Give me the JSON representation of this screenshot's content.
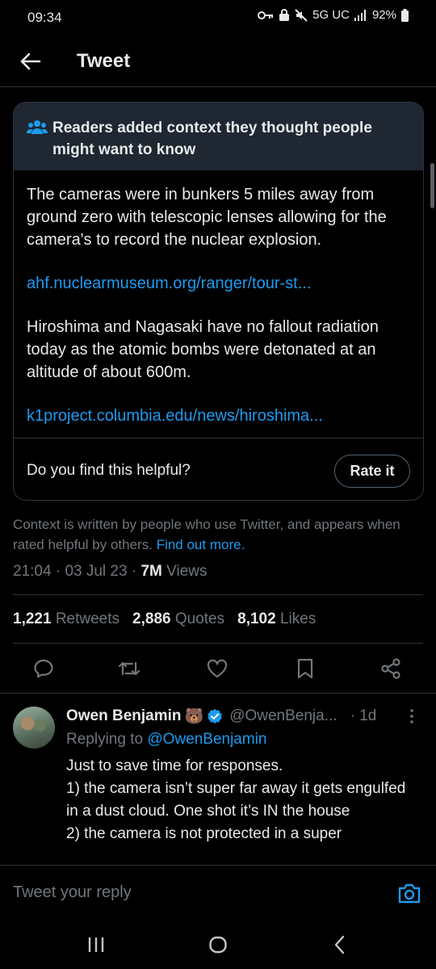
{
  "status_bar": {
    "time": "09:34",
    "network": "5G UC",
    "battery": "92%",
    "icons": [
      "key-icon",
      "lock-icon",
      "mute-icon",
      "signal-icon",
      "battery-icon"
    ]
  },
  "header": {
    "title": "Tweet",
    "back_icon": "arrow-left-icon"
  },
  "note": {
    "heading": "Readers added context they thought people might want to know",
    "heading_icon": "people-icon",
    "paragraph_1": "The cameras were in bunkers 5 miles away from ground zero with telescopic lenses allowing for the camera's to record the nuclear explosion.",
    "link_1": "ahf.nuclearmuseum.org/ranger/tour-st...",
    "paragraph_2": "Hiroshima and Nagasaki have no fallout radiation today as the atomic bombs were detonated at an altitude of about 600m.",
    "link_2": "k1project.columbia.edu/news/hiroshima...",
    "helpful_question": "Do you find this helpful?",
    "rate_button": "Rate it"
  },
  "context_info": {
    "text": "Context is written by people who use Twitter, and appears when rated helpful by others.",
    "link": "Find out more."
  },
  "meta": {
    "time": "21:04",
    "date": "03 Jul 23",
    "views_count": "7M",
    "views_label": "Views"
  },
  "stats": [
    {
      "count": "1,221",
      "label": "Retweets"
    },
    {
      "count": "2,886",
      "label": "Quotes"
    },
    {
      "count": "8,102",
      "label": "Likes"
    }
  ],
  "actions": [
    "reply-icon",
    "retweet-icon",
    "like-icon",
    "bookmark-icon",
    "share-icon"
  ],
  "reply": {
    "name": "Owen Benjamin",
    "emoji": "🐻",
    "handle": "@OwenBenja...",
    "time": "· 1d",
    "replying_prefix": "Replying to",
    "replying_to": "@OwenBenjamin",
    "lines": [
      "Just to save time for responses.",
      "1) the camera isn’t super far away it gets engulfed in a dust cloud. One shot it’s IN the house",
      "2) the camera is not protected in a super"
    ]
  },
  "compose": {
    "placeholder": "Tweet your reply",
    "camera_icon": "camera-icon"
  },
  "colors": {
    "background": "#000000",
    "accent": "#1d9bf0",
    "note_header": "#1e2732",
    "muted": "#71767b",
    "verified": "#1d9bf0"
  }
}
